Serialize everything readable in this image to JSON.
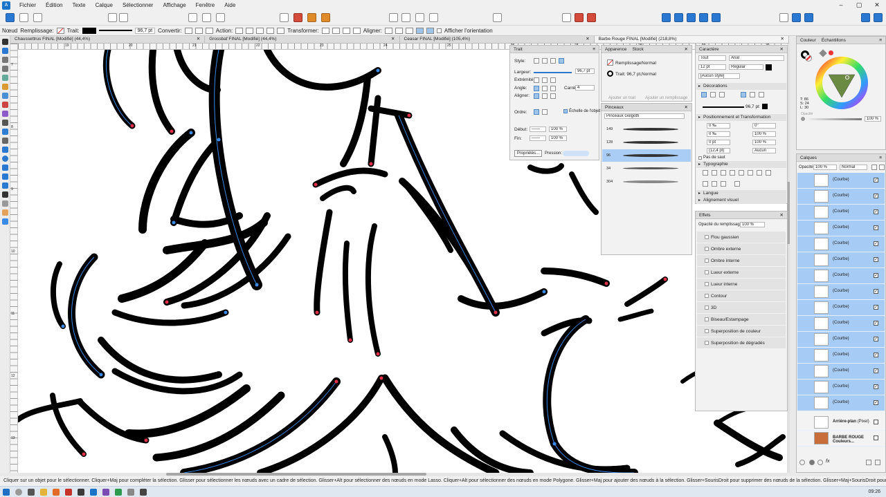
{
  "menu": [
    "Fichier",
    "Édition",
    "Texte",
    "Calque",
    "Sélectionner",
    "Affichage",
    "Fenêtre",
    "Aide"
  ],
  "context_bar": {
    "tool": "Nœud",
    "fill_label": "Remplissage:",
    "stroke_label": "Trait:",
    "stroke_width": "96,7 pt",
    "convert_label": "Convertir:",
    "action_label": "Action:",
    "transform_label": "Transformer:",
    "align_label": "Aligner:",
    "show_orientation": "Afficher l'orientation"
  },
  "tabs": [
    {
      "label": "Chaussettrus FINAL [Modifié] (44,4%)"
    },
    {
      "label": "Grossbaf FINAL [Modifié] (44,4%)"
    },
    {
      "label": "Ceasar FINAL [Modifié] (105,4%)"
    },
    {
      "label": "Barbe Rouge FINAL [Modifié] (218,8%)",
      "active": true
    }
  ],
  "trait_panel": {
    "title": "Trait",
    "style_label": "Style:",
    "width_label": "Largeur:",
    "width_value": "96,7 pt",
    "end_label": "Extrémité:",
    "angle_label": "Angle:",
    "join_label": "Carré:",
    "join_value": "4",
    "align_label": "Aligner:",
    "order_label": "Ordre:",
    "scale_label": "Échelle de l'objet",
    "start_label": "Début:",
    "start_value": "100 %",
    "end2_label": "Fin:",
    "end2_value": "100 %",
    "props_label": "Propriétés...",
    "pressure_label": "Pression:"
  },
  "appearance_panel": {
    "tabs": [
      "Apparence",
      "Stock"
    ],
    "fill_label": "Remplissage:",
    "fill_mode": "Normal",
    "stroke_label": "Trait: 96,7 pt,",
    "stroke_mode": "Normal",
    "add_stroke": "Ajouter un trait",
    "add_fill": "Ajouter un remplissage"
  },
  "brushes_panel": {
    "title": "Pinceaux",
    "category": "Pinceaux Golgoth",
    "sizes": [
      "149",
      "128",
      "96",
      "34",
      "304"
    ],
    "selected_index": 2
  },
  "character_panel": {
    "title": "Caractère",
    "scope": "Tout",
    "font": "Arial",
    "size": "12 pt",
    "weight": "Regular",
    "style": "[Aucun style]",
    "decorations": "Décorations",
    "deco_width": "96,7 pt",
    "position_section": "Positionnement et Transformation",
    "fields": [
      "0 ‰",
      "0°",
      "0 ‰",
      "100 %",
      "0 pt",
      "100 %",
      "(12,4 pt)",
      "Aucun"
    ],
    "no_break": "Pas de saut",
    "typography": "Typographie",
    "language": "Langue",
    "align": "Alignement visuel"
  },
  "effects_panel": {
    "title": "Effets",
    "opacity_label": "Opacité du remplissage:",
    "opacity_value": "100 %",
    "items": [
      "Flou gaussien",
      "Ombre externe",
      "Ombre interne",
      "Lueur externe",
      "Lueur interne",
      "Contour",
      "3D",
      "Biseau/Estampage",
      "Superposition de couleur",
      "Superposition de dégradés"
    ]
  },
  "color_panel": {
    "tabs": [
      "Couleur",
      "Échantillons"
    ],
    "hsl": [
      "T: 86",
      "S: 24",
      "L: 30"
    ],
    "opacity_label": "Opacité",
    "opacity_value": "100 %"
  },
  "layers_panel": {
    "title": "Calques",
    "opacity_label": "Opacité:",
    "opacity_value": "100 %",
    "blend": "Normal",
    "curve_label": "(Courbe)",
    "curve_count": 15,
    "background": "Arrière-plan",
    "background_type": "(Pixel)",
    "group": "BARBE ROUGE Couleurs..."
  },
  "ruler": {
    "h_labels": [
      "19",
      "20",
      "21",
      "22",
      "23",
      "24",
      "25",
      "26",
      "27",
      "28",
      "29",
      "30"
    ],
    "v_labels": [
      "7",
      "8",
      "9",
      "10",
      "11",
      "12",
      "13",
      "14"
    ]
  },
  "status": "Cliquer sur un objet pour le sélectionner. Cliquer+Maj pour compléter la sélection. Glisser pour sélectionner les nœuds avec un cadre de sélection. Glisser+Alt pour sélectionner des nœuds en mode Lasso. Cliquer+Alt pour sélectionner des nœuds en mode Polygone. Glisser+Maj pour ajouter des nœuds à la sélection. Glisser+SourisDroit pour supprimer des nœuds de la sélection. Glisser+Maj+SourisDroit pour permuter la sélection de nœuds.",
  "clock": "09:26",
  "colors": {
    "accent": "#2b78d0",
    "selection": "#a6ccf5",
    "node_blue": "#3a8be6",
    "node_red": "#e0304a"
  }
}
